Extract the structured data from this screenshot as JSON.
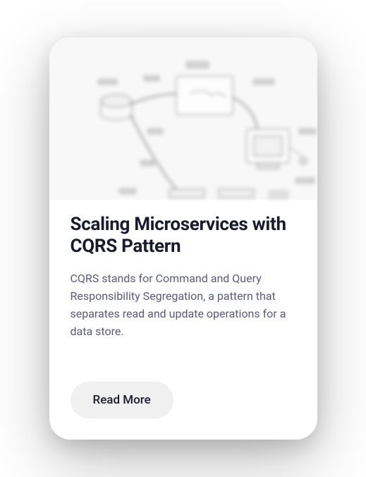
{
  "card": {
    "title": "Scaling Microservices with CQRS Pattern",
    "description": "CQRS stands for Command and Query Responsibility Segregation, a pattern that separates read and update operations for a data store.",
    "button_label": "Read More"
  }
}
